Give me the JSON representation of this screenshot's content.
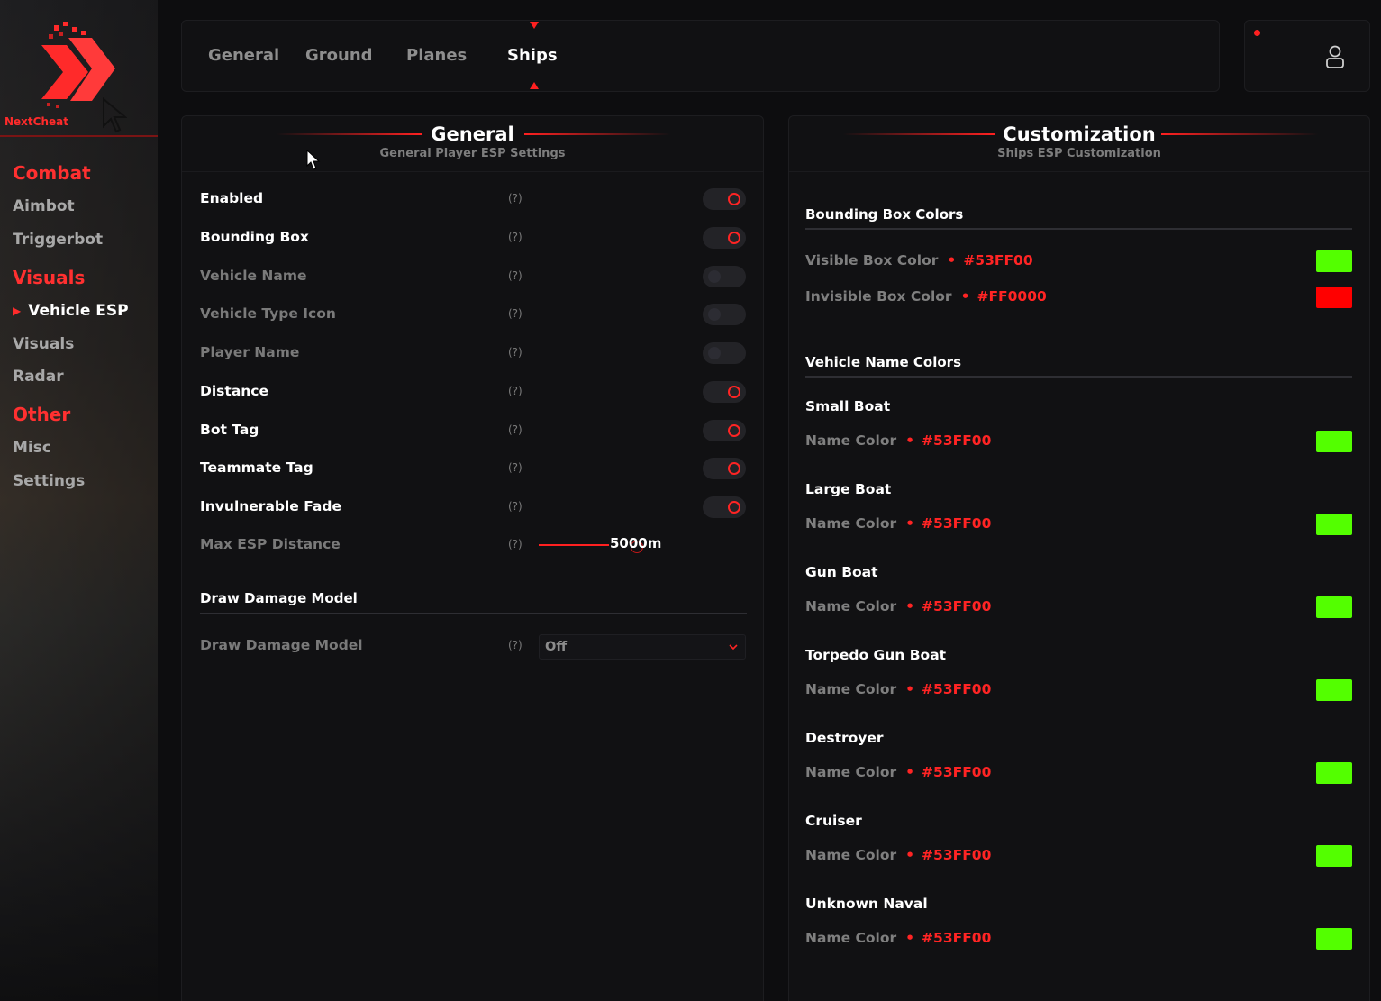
{
  "brand": {
    "name": "NextCheat",
    "accent": "#FF2424"
  },
  "sidebar": {
    "sections": [
      {
        "label": "Combat",
        "items": [
          "Aimbot",
          "Triggerbot"
        ]
      },
      {
        "label": "Visuals",
        "items": [
          "Vehicle ESP",
          "Visuals",
          "Radar"
        ]
      },
      {
        "label": "Other",
        "items": [
          "Misc",
          "Settings"
        ]
      }
    ],
    "active_item": "Vehicle ESP"
  },
  "tabs": [
    "General",
    "Ground",
    "Planes",
    "Ships"
  ],
  "active_tab": "Ships",
  "user": {
    "icon": "user-icon",
    "status_icon": "status-dot"
  },
  "general_panel": {
    "title": "General",
    "subtitle": "General Player ESP Settings",
    "rows": [
      {
        "label": "Enabled",
        "help": "(?)",
        "enabled": true
      },
      {
        "label": "Bounding Box",
        "help": "(?)",
        "enabled": true
      },
      {
        "label": "Vehicle Name",
        "help": "(?)",
        "enabled": false
      },
      {
        "label": "Vehicle Type Icon",
        "help": "(?)",
        "enabled": false
      },
      {
        "label": "Player Name",
        "help": "(?)",
        "enabled": false
      },
      {
        "label": "Distance",
        "help": "(?)",
        "enabled": true
      },
      {
        "label": "Bot Tag",
        "help": "(?)",
        "enabled": true
      },
      {
        "label": "Teammate Tag",
        "help": "(?)",
        "enabled": true
      },
      {
        "label": "Invulnerable Fade",
        "help": "(?)",
        "enabled": true
      }
    ],
    "max_distance": {
      "label": "Max ESP Distance",
      "help": "(?)",
      "value": "5000m"
    },
    "damage_section": {
      "title": "Draw Damage Model",
      "label": "Draw Damage Model",
      "help": "(?)",
      "value": "Off"
    }
  },
  "custom_panel": {
    "title": "Customization",
    "subtitle": "Ships ESP Customization",
    "box_section": {
      "title": "Bounding Box Colors",
      "rows": [
        {
          "label": "Visible Box Color",
          "hex": "#53FF00",
          "color": "#53FF00"
        },
        {
          "label": "Invisible Box Color",
          "hex": "#FF0000",
          "color": "#FF0000"
        }
      ]
    },
    "name_section": {
      "title": "Vehicle Name Colors",
      "items": [
        {
          "name": "Small Boat",
          "label": "Name Color",
          "hex": "#53FF00",
          "color": "#53FF00"
        },
        {
          "name": "Large Boat",
          "label": "Name Color",
          "hex": "#53FF00",
          "color": "#53FF00"
        },
        {
          "name": "Gun Boat",
          "label": "Name Color",
          "hex": "#53FF00",
          "color": "#53FF00"
        },
        {
          "name": "Torpedo Gun Boat",
          "label": "Name Color",
          "hex": "#53FF00",
          "color": "#53FF00"
        },
        {
          "name": "Destroyer",
          "label": "Name Color",
          "hex": "#53FF00",
          "color": "#53FF00"
        },
        {
          "name": "Cruiser",
          "label": "Name Color",
          "hex": "#53FF00",
          "color": "#53FF00"
        },
        {
          "name": "Unknown Naval",
          "label": "Name Color",
          "hex": "#53FF00",
          "color": "#53FF00"
        }
      ]
    }
  }
}
